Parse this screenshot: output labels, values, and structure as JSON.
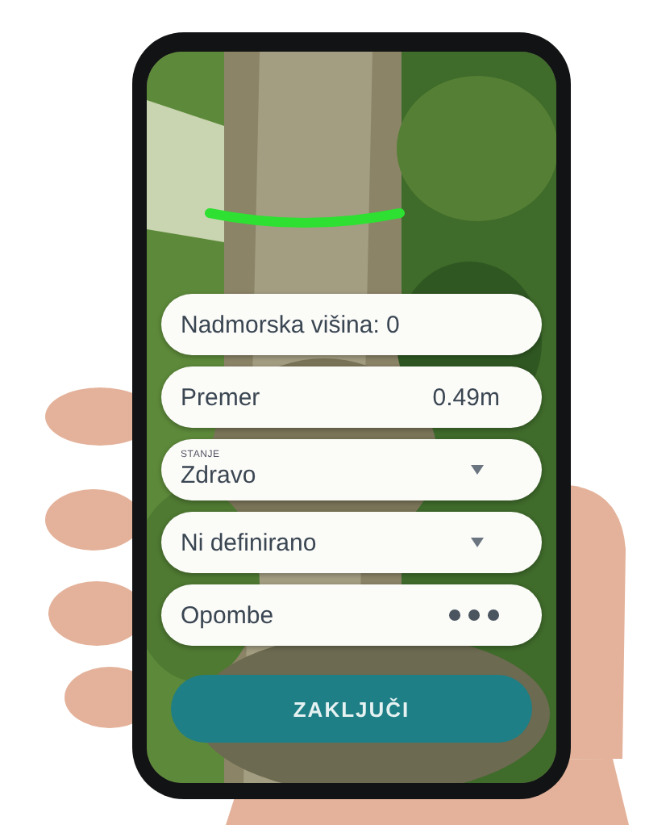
{
  "fields": [
    {
      "kind": "readout",
      "label": "Nadmorska višina: 0"
    },
    {
      "kind": "value",
      "label": "Premer",
      "value": "0.49m"
    },
    {
      "kind": "select",
      "caption": "STANJE",
      "value": "Zdravo"
    },
    {
      "kind": "select",
      "value": "Ni definirano"
    },
    {
      "kind": "more",
      "label": "Opombe"
    }
  ],
  "button": {
    "label": "ZAKLJUČI"
  }
}
